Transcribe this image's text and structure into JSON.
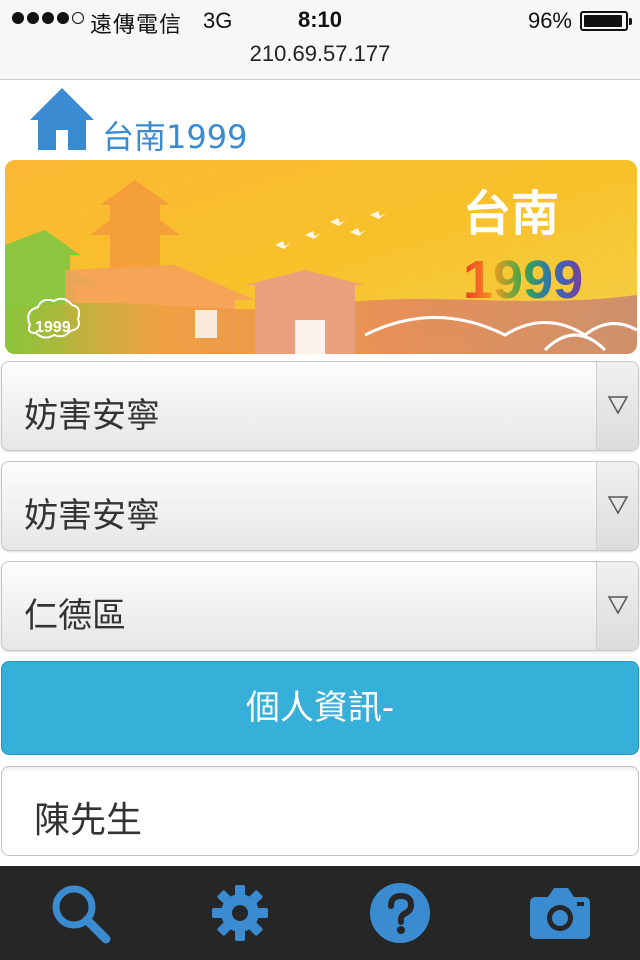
{
  "status_bar": {
    "carrier": "遠傳電信",
    "network": "3G",
    "time": "8:10",
    "battery_percent_text": "96%",
    "battery_level": 0.96
  },
  "url_bar": {
    "url": "210.69.57.177"
  },
  "header": {
    "home_icon": "home-icon",
    "title": "台南1999"
  },
  "banner": {
    "city_text": "台南",
    "number_text": "1999",
    "badge_text": "1999"
  },
  "selects": [
    {
      "value": "妨害安寧"
    },
    {
      "value": "妨害安寧"
    },
    {
      "value": "仁德區"
    }
  ],
  "section_header": {
    "label": "個人資訊-"
  },
  "name_field": {
    "value": "陳先生"
  },
  "tab_bar": {
    "icons": [
      "search-icon",
      "gear-icon",
      "help-icon",
      "camera-icon"
    ]
  },
  "colors": {
    "accent_blue": "#3b8bd0",
    "section_header_bg": "#36b0d8",
    "tab_bar_bg": "#262626"
  }
}
